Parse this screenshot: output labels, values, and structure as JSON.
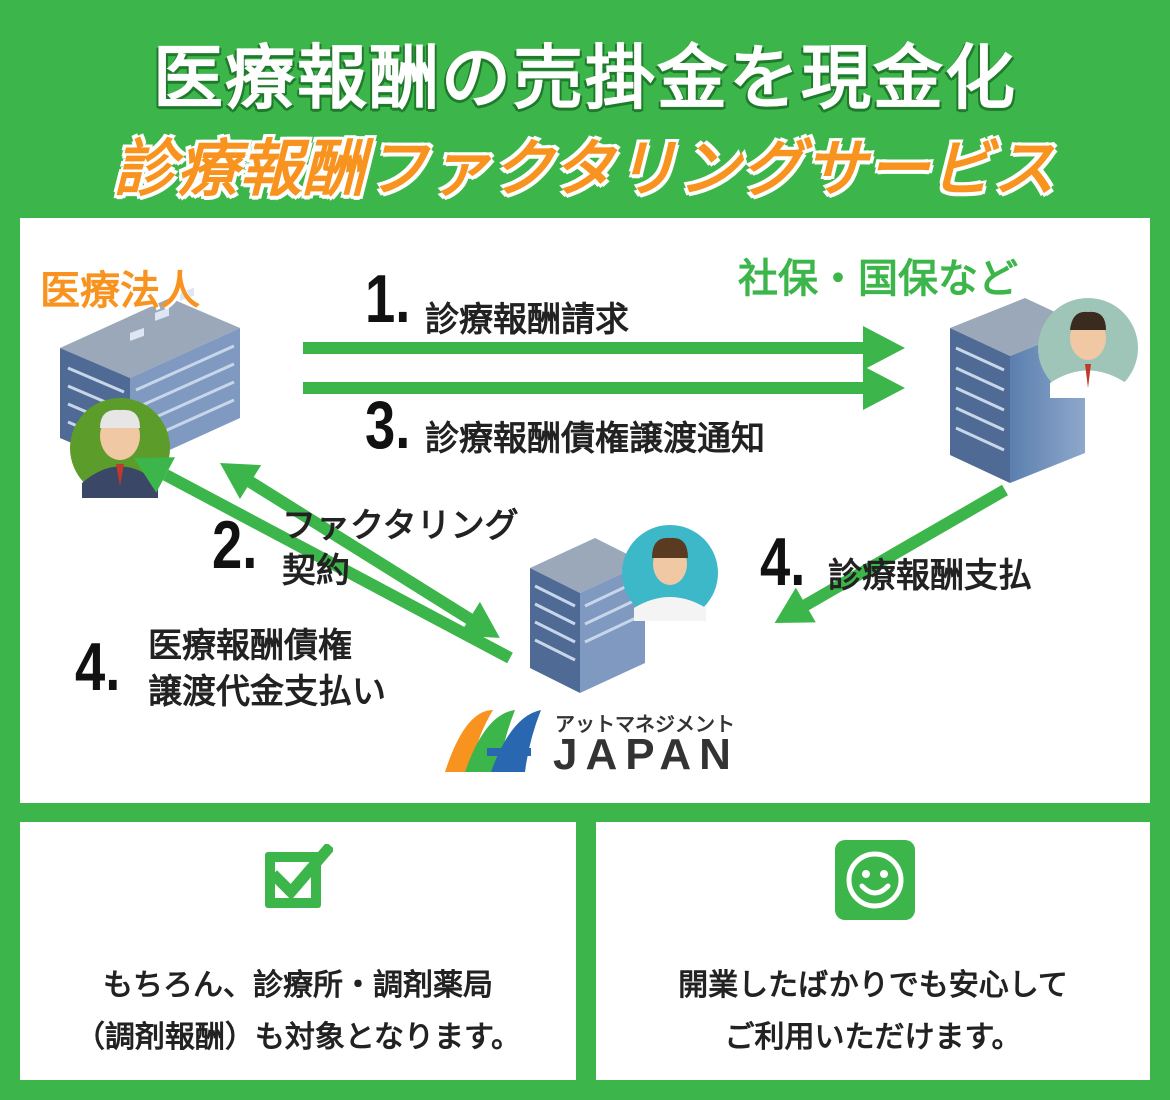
{
  "header": {
    "title": "医療報酬の売掛金を現金化",
    "subtitle": "診療報酬ファクタリングサービス"
  },
  "diagram": {
    "left_org": "医療法人",
    "right_org": "社保・国保など",
    "steps": [
      {
        "num": "1.",
        "text": "診療報酬請求"
      },
      {
        "num": "3.",
        "text": "診療報酬債権譲渡通知"
      },
      {
        "num": "2.",
        "line1": "ファクタリング",
        "line2": "契約"
      },
      {
        "num": "4.",
        "text": "診療報酬支払"
      },
      {
        "num": "4.",
        "line1": "医療報酬債権",
        "line2": "譲渡代金支払い"
      }
    ],
    "logo": {
      "sub": "アットマネジメント",
      "main": "JAPAN"
    }
  },
  "cards": [
    {
      "line1": "もちろん、診療所・調剤薬局",
      "line2": "（調剤報酬）も対象となります。",
      "icon": "checkbox-icon"
    },
    {
      "line1": "開業したばかりでも安心して",
      "line2": "ご利用いただけます。",
      "icon": "smiley-icon"
    }
  ],
  "colors": {
    "green": "#3cb54a",
    "orange": "#f7931e",
    "arrow": "#3cb54a"
  }
}
